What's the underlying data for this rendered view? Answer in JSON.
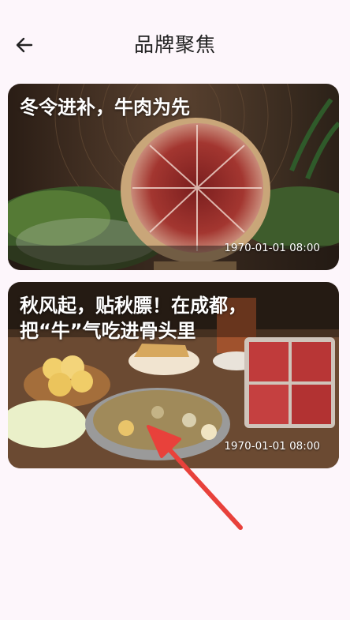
{
  "header": {
    "title": "品牌聚焦",
    "back_icon": "arrow-left-icon"
  },
  "articles": [
    {
      "title": "冬令进补，牛肉为先",
      "time": "1970-01-01 08:00",
      "image": "beef-platter-photo"
    },
    {
      "title": "秋风起，贴秋膘！在成都，\n把“牛”气吃进骨头里",
      "time": "1970-01-01 08:00",
      "image": "hotpot-table-photo"
    }
  ],
  "overlay": {
    "annotation": "red-pointer-arrow",
    "color": "#e8413b"
  }
}
